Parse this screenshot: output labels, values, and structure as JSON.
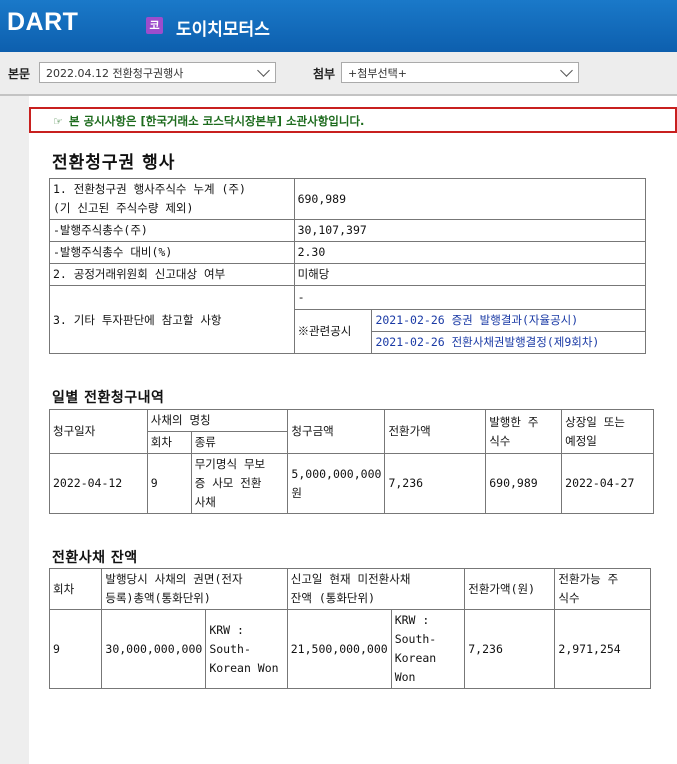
{
  "header": {
    "logo": "DART",
    "corp_badge": "코",
    "corp_name": "도이치모터스"
  },
  "toolbar": {
    "doc_label": "본문",
    "doc_select": "2022.04.12  전환청구권행사",
    "attach_label": "첨부",
    "attach_select": "+첨부선택+"
  },
  "notice": {
    "text": "본 공시사항은 [한국거래소 코스닥시장본부] 소관사항입니다."
  },
  "doc_title": "전환청구권 행사",
  "summary": {
    "r1_label_a": "1. 전환청구권 행사주식수 누계 (주)",
    "r1_label_b": "(기 신고된 주식수량 제외)",
    "r1_value": "690,989",
    "r2_label": "-발행주식총수(주)",
    "r2_value": "30,107,397",
    "r3_label": "-발행주식총수 대비(%)",
    "r3_value": "2.30",
    "r4_label": "2. 공정거래위원회 신고대상 여부",
    "r4_value": "미해당",
    "r5_label": "3. 기타 투자판단에 참고할 사항",
    "r5_value": "-",
    "related_label": "※관련공시",
    "related_1": "2021-02-26 증권 발행결과(자율공시)",
    "related_2": "2021-02-26 전환사채권발행결정(제9회차)"
  },
  "daily": {
    "title": "일별 전환청구내역",
    "h_date": "청구일자",
    "h_bond": "사채의 명칭",
    "h_round": "회차",
    "h_kind": "종류",
    "h_amount": "청구금액",
    "h_price": "전환가액",
    "h_shares_a": "발행한 주",
    "h_shares_b": "식수",
    "h_listing_a": "상장일 또는",
    "h_listing_b": "예정일",
    "row": {
      "date": "2022-04-12",
      "round": "9",
      "kind_1": "무기명식 무보",
      "kind_2": "증 사모 전환",
      "kind_3": "사채",
      "amount_1": "5,000,000,000",
      "amount_2": "원",
      "price": "7,236",
      "shares": "690,989",
      "listing": "2022-04-27"
    }
  },
  "balance": {
    "title": "전환사채 잔액",
    "h_round": "회차",
    "h_face_a": "발행당시 사채의 권면(전자",
    "h_face_b": "등록)총액(통화단위)",
    "h_remain_a": "신고일 현재 미전환사채",
    "h_remain_b": "잔액 (통화단위)",
    "h_price": "전환가액(원)",
    "h_conv_a": "전환가능 주",
    "h_conv_b": "식수",
    "row": {
      "round": "9",
      "face": "30,000,000,000",
      "face_cur_1": "KRW :",
      "face_cur_2": "South-",
      "face_cur_3": "Korean Won",
      "remain": "21,500,000,000",
      "remain_cur_1": "KRW :",
      "remain_cur_2": "South-",
      "remain_cur_3": "Korean Won",
      "price": "7,236",
      "conv": "2,971,254"
    }
  }
}
